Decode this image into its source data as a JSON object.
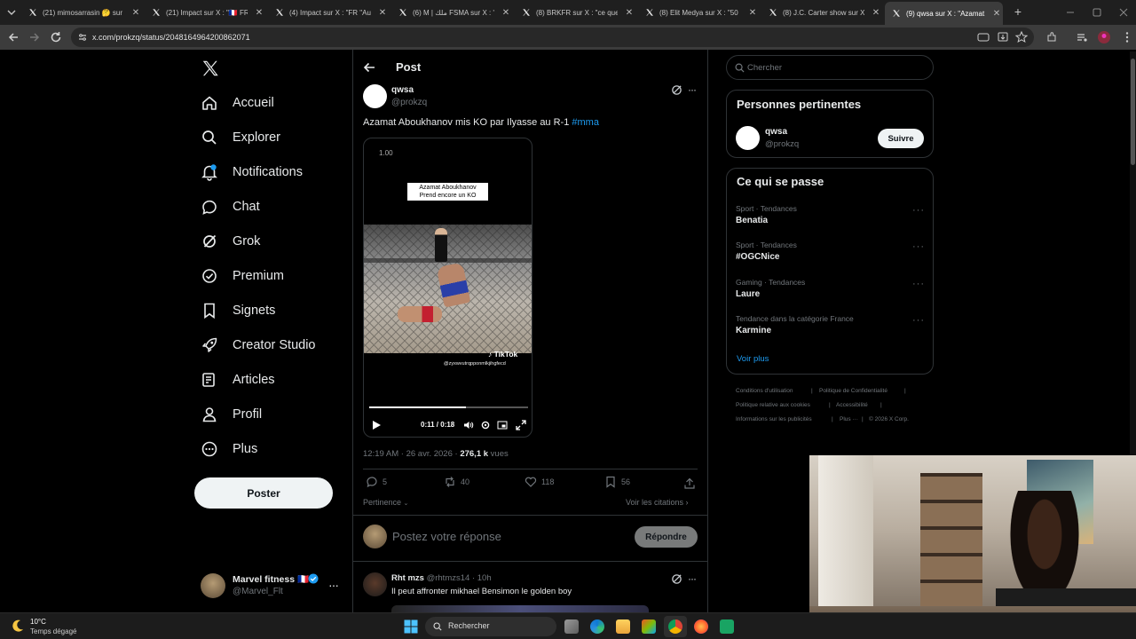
{
  "browser": {
    "tabs": [
      {
        "title": "(21) mimosarrasin 🤔 sur"
      },
      {
        "title": "(21) Impact sur X : \"🇫🇷 FR"
      },
      {
        "title": "(4) Impact sur X : \"FR \"Au"
      },
      {
        "title": "(6) M | ملك FSMA sur X : \"l"
      },
      {
        "title": "(8) BRKFR sur X : \"ce que"
      },
      {
        "title": "(8) Elit Medya sur X : \"50"
      },
      {
        "title": "(8) J.C. Carter show sur X"
      },
      {
        "title": "(9) qwsa sur X : \"Azamat"
      }
    ],
    "url": "x.com/prokzq/status/2048164964200862071"
  },
  "nav": {
    "items": [
      {
        "label": "Accueil",
        "icon": "home-icon"
      },
      {
        "label": "Explorer",
        "icon": "search-icon"
      },
      {
        "label": "Notifications",
        "icon": "bell-icon"
      },
      {
        "label": "Chat",
        "icon": "chat-icon"
      },
      {
        "label": "Grok",
        "icon": "grok-icon"
      },
      {
        "label": "Premium",
        "icon": "premium-icon"
      },
      {
        "label": "Signets",
        "icon": "bookmark-icon"
      },
      {
        "label": "Creator Studio",
        "icon": "rocket-icon"
      },
      {
        "label": "Articles",
        "icon": "article-icon"
      },
      {
        "label": "Profil",
        "icon": "profile-icon"
      },
      {
        "label": "Plus",
        "icon": "more-circle-icon"
      }
    ],
    "post_button": "Poster",
    "account": {
      "name": "Marvel fitness 🇫🇷",
      "handle": "@Marvel_Flt"
    }
  },
  "post": {
    "header": "Post",
    "author_name": "qwsa",
    "author_handle": "@prokzq",
    "text": "Azamat Aboukhanov mis KO par Ilyasse au R-1",
    "hashtag": "#mma",
    "video": {
      "caption_line1": "Azamat Aboukhanov",
      "caption_line2": "Prend encore un KO",
      "corner_value": "1.00",
      "watermark": "TikTok",
      "watermark_handle": "@zyxwvutrqpponmlkjihgfecd",
      "time": "0:11 / 0:18",
      "progress": 0.61
    },
    "timestamp": "12:19 AM · 26 avr. 2026 ·",
    "views_count": "276,1 k",
    "views_label": "vues",
    "replies": "5",
    "reposts": "40",
    "likes": "118",
    "bookmarks": "56",
    "sort_label": "Pertinence",
    "quotes_link": "Voir les citations",
    "reply_placeholder": "Postez votre réponse",
    "reply_button": "Répondre"
  },
  "reply": {
    "name": "Rht mzs",
    "handle": "@rhtmzs14 · 10h",
    "text": "Il peut affronter mikhael Bensimon le golden boy"
  },
  "sidebar": {
    "search_placeholder": "Chercher",
    "relevant_title": "Personnes pertinentes",
    "relevant_person": {
      "name": "qwsa",
      "handle": "@prokzq",
      "follow": "Suivre"
    },
    "trends_title": "Ce qui se passe",
    "trends": [
      {
        "category": "Sport · Tendances",
        "name": "Benatia"
      },
      {
        "category": "Sport · Tendances",
        "name": "#OGCNice"
      },
      {
        "category": "Gaming · Tendances",
        "name": "Laure"
      },
      {
        "category": "Tendance dans la catégorie France",
        "name": "Karmine"
      }
    ],
    "show_more": "Voir plus",
    "footer": {
      "line1a": "Conditions d'utilisation",
      "line1b": "Politique de Confidentialité",
      "line2a": "Politique relative aux cookies",
      "line2b": "Accessibilité",
      "line3a": "Informations sur les publicités",
      "line3b": "Plus ···",
      "line3c": "© 2026 X Corp."
    }
  },
  "taskbar": {
    "weather_temp": "10°C",
    "weather_desc": "Temps dégagé",
    "search": "Rechercher"
  },
  "colors": {
    "accent": "#1d9bf0",
    "bg": "#000000",
    "border": "#2f3336",
    "muted": "#71767b"
  }
}
